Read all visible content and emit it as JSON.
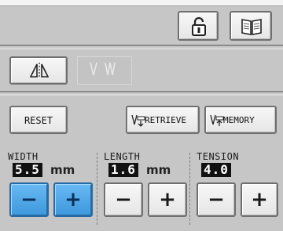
{
  "header": {
    "lock_icon": "lock-icon",
    "manual_icon": "book-icon"
  },
  "toolbar": {
    "mirror_icon": "mirror-pattern-icon",
    "needle_icon": "needle-mode-icon"
  },
  "actions": {
    "reset_label": "RESET",
    "retrieve_label": "RETRIEVE",
    "memory_label": "MEMORY"
  },
  "settings": {
    "width": {
      "label": "WIDTH",
      "value": "5.5",
      "unit": "mm",
      "minus": "−",
      "plus": "+"
    },
    "length": {
      "label": "LENGTH",
      "value": "1.6",
      "unit": "mm",
      "minus": "−",
      "plus": "+"
    },
    "tension": {
      "label": "TENSION",
      "value": "4.0",
      "minus": "−",
      "plus": "+"
    }
  },
  "colors": {
    "accent": "#4aa6e6",
    "panel": "#c6c6c6"
  }
}
